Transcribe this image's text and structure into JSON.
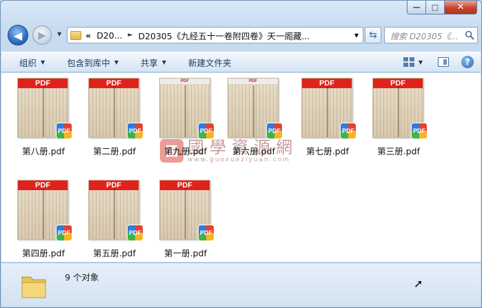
{
  "window": {
    "minimize_label": "—",
    "maximize_label": "□",
    "close_label": "✕"
  },
  "navigation": {
    "back_glyph": "◀",
    "forward_glyph": "▶",
    "history_dropdown_glyph": "▼"
  },
  "address": {
    "overflow_glyph": "«",
    "crumbs": [
      "D20...",
      "D20305《九经五十一卷附四卷》天一阁藏..."
    ],
    "separator_glyph": "►",
    "dropdown_glyph": "▼",
    "refresh_glyph": "⇆"
  },
  "search": {
    "placeholder": "搜索 D20305《..."
  },
  "toolbar": {
    "organize": "组织",
    "include_in_library": "包含到库中",
    "share": "共享",
    "new_folder": "新建文件夹",
    "dropdown_glyph": "▼",
    "help_glyph": "?"
  },
  "files": [
    {
      "name": "第八册.pdf",
      "banner": "PDF"
    },
    {
      "name": "第二册.pdf",
      "banner": "PDF"
    },
    {
      "name": "第九册.pdf",
      "banner": "PDF"
    },
    {
      "name": "第六册.pdf",
      "banner": "PDF"
    },
    {
      "name": "第七册.pdf",
      "banner": "PDF"
    },
    {
      "name": "第三册.pdf",
      "banner": "PDF"
    },
    {
      "name": "第四册.pdf",
      "banner": "PDF"
    },
    {
      "name": "第五册.pdf",
      "banner": "PDF"
    },
    {
      "name": "第一册.pdf",
      "banner": "PDF"
    }
  ],
  "pdf_badge_label": "PDF",
  "watermark": {
    "seal": "國",
    "main": "國學資源網",
    "url": "www.guoxueziyuan.com"
  },
  "status": {
    "item_count": "9 个对象"
  },
  "colors": {
    "pdf_banner": "#e0221c",
    "accent": "#2d6cc0"
  }
}
